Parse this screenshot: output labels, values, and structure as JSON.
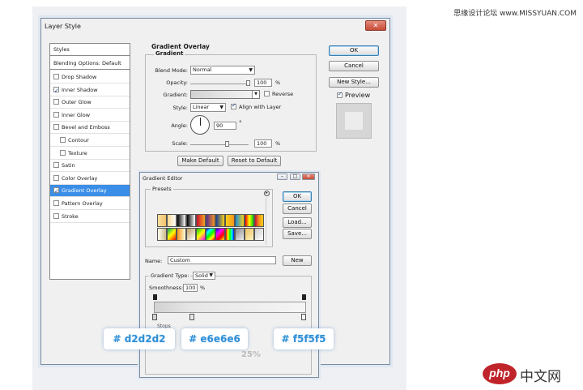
{
  "watermark": "思缘设计论坛 www.MISSYUAN.COM",
  "logo": {
    "php": "php",
    "cn": "中文网"
  },
  "dialog": {
    "title": "Layer Style",
    "close": "✕",
    "styles_list": [
      {
        "label": "Styles",
        "checkbox": false,
        "checked": false,
        "indent": false,
        "header": true
      },
      {
        "label": "Blending Options: Default",
        "checkbox": false,
        "checked": false,
        "indent": false,
        "header": true
      },
      {
        "label": "Drop Shadow",
        "checkbox": true,
        "checked": false,
        "indent": false
      },
      {
        "label": "Inner Shadow",
        "checkbox": true,
        "checked": true,
        "indent": false
      },
      {
        "label": "Outer Glow",
        "checkbox": true,
        "checked": false,
        "indent": false
      },
      {
        "label": "Inner Glow",
        "checkbox": true,
        "checked": false,
        "indent": false
      },
      {
        "label": "Bevel and Emboss",
        "checkbox": true,
        "checked": false,
        "indent": false
      },
      {
        "label": "Contour",
        "checkbox": true,
        "checked": false,
        "indent": true
      },
      {
        "label": "Texture",
        "checkbox": true,
        "checked": false,
        "indent": true
      },
      {
        "label": "Satin",
        "checkbox": true,
        "checked": false,
        "indent": false
      },
      {
        "label": "Color Overlay",
        "checkbox": true,
        "checked": false,
        "indent": false
      },
      {
        "label": "Gradient Overlay",
        "checkbox": true,
        "checked": true,
        "indent": false,
        "selected": true
      },
      {
        "label": "Pattern Overlay",
        "checkbox": true,
        "checked": false,
        "indent": false
      },
      {
        "label": "Stroke",
        "checkbox": true,
        "checked": false,
        "indent": false
      }
    ],
    "ok": "OK",
    "cancel": "Cancel",
    "new_style": "New Style...",
    "preview": "Preview",
    "section_title": "Gradient Overlay",
    "group_title": "Gradient",
    "blend_mode_label": "Blend Mode:",
    "blend_mode": "Normal",
    "opacity_label": "Opacity:",
    "opacity": "100",
    "pct": "%",
    "gradient_label": "Gradient:",
    "reverse": "Reverse",
    "style_label": "Style:",
    "style": "Linear",
    "align": "Align with Layer",
    "angle_label": "Angle:",
    "angle": "90",
    "deg": "°",
    "scale_label": "Scale:",
    "scale": "100",
    "make_default": "Make Default",
    "reset_default": "Reset to Default"
  },
  "editor": {
    "title": "Gradient Editor",
    "ctl_min": "–",
    "ctl_max": "□",
    "ctl_close": "✕",
    "presets_label": "Presets",
    "ok": "OK",
    "cancel": "Cancel",
    "load": "Load...",
    "save": "Save...",
    "name_label": "Name:",
    "name_value": "Custom",
    "new": "New",
    "type_label": "Gradient Type:",
    "type_value": "Solid",
    "smooth_label": "Smoothness:",
    "smooth_value": "100",
    "pct": "%",
    "stops_label": "Stops"
  },
  "callouts": {
    "hex1": "# d2d2d2",
    "hex2": "# e6e6e6",
    "hex3": "# f5f5f5",
    "location": "25%"
  },
  "colors": {
    "stop1": "#d2d2d2",
    "stop2": "#e6e6e6",
    "stop3": "#f5f5f5",
    "accent": "#3b8ee8"
  }
}
